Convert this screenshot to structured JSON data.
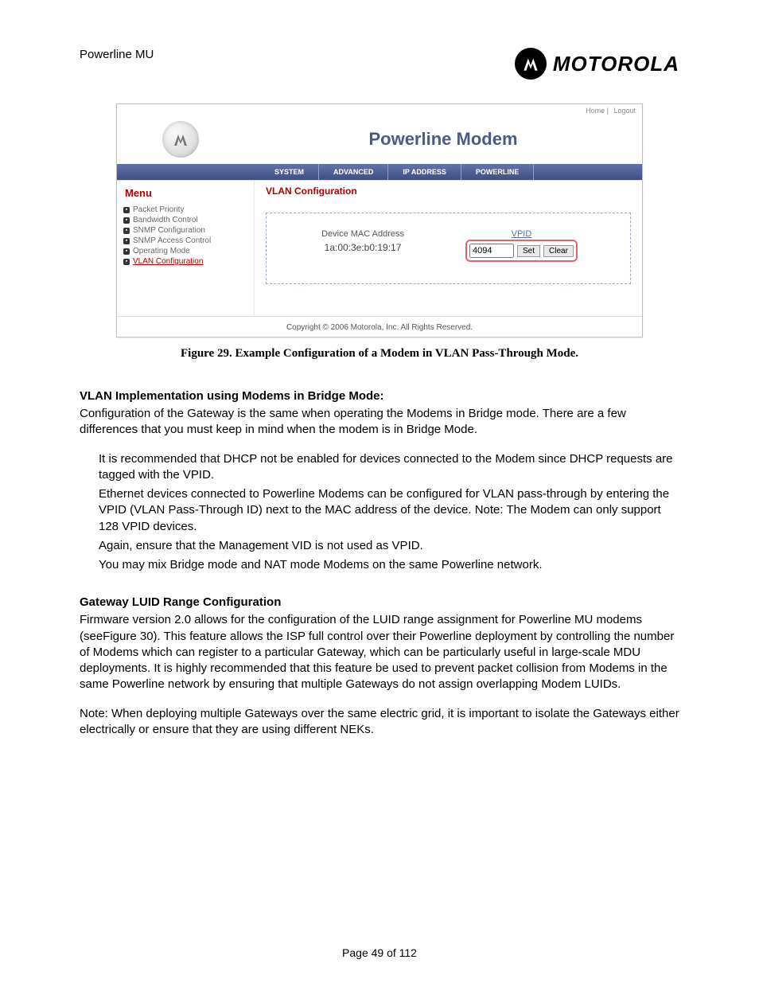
{
  "doc": {
    "header_title": "Powerline MU",
    "brand": "MOTOROLA",
    "page_label": "Page 49 of 112"
  },
  "figure": {
    "caption": "Figure 29. Example Configuration of a Modem in VLAN Pass-Through Mode."
  },
  "shot": {
    "top_links": {
      "home": "Home",
      "logout": "Logout"
    },
    "banner_title": "Powerline Modem",
    "tabs": {
      "system": "SYSTEM",
      "advanced": "ADVANCED",
      "ip": "IP ADDRESS",
      "powerline": "POWERLINE"
    },
    "menu_title": "Menu",
    "menu_items": [
      "Packet Priority",
      "Bandwidth Control",
      "SNMP Configuration",
      "SNMP Access Control",
      "Operating Mode",
      "VLAN Configuration"
    ],
    "section_title": "VLAN Configuration",
    "table": {
      "mac_label": "Device MAC Address",
      "mac_value": "1a:00:3e:b0:19:17",
      "vpid_label": "VPID",
      "vpid_value": "4094",
      "set_btn": "Set",
      "clear_btn": "Clear"
    },
    "copyright": "Copyright  ©   2006  Motorola, Inc.  All Rights Reserved."
  },
  "section1": {
    "heading": "VLAN Implementation using Modems in Bridge Mode:",
    "para": "Configuration of the Gateway is the same when operating the Modems in Bridge mode. There are a few differences that you must keep in mind when the modem is in Bridge Mode.",
    "b1": "It is recommended that DHCP not be enabled for devices connected to the Modem since DHCP requests are tagged with the VPID.",
    "b2": "Ethernet devices connected to Powerline Modems can be configured for VLAN pass-through by entering the VPID (VLAN Pass-Through ID) next to the MAC address of the device. Note: The Modem can only support 128 VPID devices.",
    "b3": "Again, ensure that the Management VID is not used as VPID.",
    "b4": "You may mix Bridge mode and NAT mode Modems on the same Powerline network."
  },
  "section2": {
    "heading": "Gateway LUID Range Configuration",
    "p1": "Firmware version 2.0 allows for the configuration of the LUID range assignment for Powerline MU modems (seeFigure 30).  This feature allows the ISP full control over their Powerline deployment by controlling the number of Modems which can register to a particular Gateway, which can be particularly useful in large-scale MDU deployments.  It is highly recommended that this feature be used to prevent packet collision from Modems in the same Powerline network by ensuring that multiple Gateways do not assign overlapping Modem LUIDs.",
    "p2": "Note:  When deploying multiple Gateways over the same electric grid, it is important to isolate the Gateways either electrically or ensure that they are using different NEKs."
  }
}
